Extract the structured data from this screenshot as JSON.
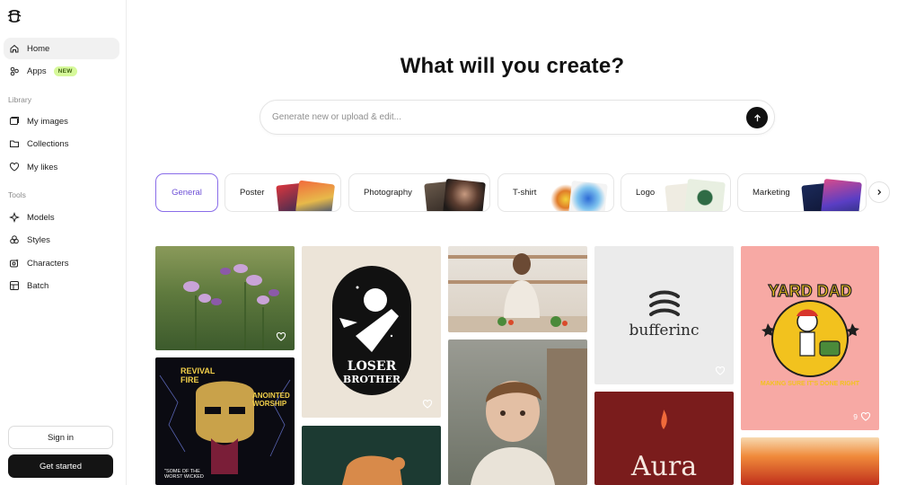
{
  "sidebar": {
    "nav": [
      {
        "label": "Home",
        "badge": ""
      },
      {
        "label": "Apps",
        "badge": "NEW"
      }
    ],
    "library_label": "Library",
    "library": [
      {
        "label": "My images"
      },
      {
        "label": "Collections"
      },
      {
        "label": "My likes"
      }
    ],
    "tools_label": "Tools",
    "tools": [
      {
        "label": "Models"
      },
      {
        "label": "Styles"
      },
      {
        "label": "Characters"
      },
      {
        "label": "Batch"
      }
    ],
    "sign_in": "Sign in",
    "get_started": "Get started"
  },
  "main": {
    "headline": "What will you create?",
    "search_placeholder": "Generate new or upload & edit..."
  },
  "categories": [
    {
      "label": "General",
      "selected": true
    },
    {
      "label": "Poster",
      "selected": false
    },
    {
      "label": "Photography",
      "selected": false
    },
    {
      "label": "T-shirt",
      "selected": false
    },
    {
      "label": "Logo",
      "selected": false
    },
    {
      "label": "Marketing",
      "selected": false
    }
  ],
  "gallery": {
    "logo_tile_text": "bufferinc",
    "poster_tile_line1": "LOSER",
    "poster_tile_line2": "BROTHER",
    "tshirt_tile_top": "YARD DAD",
    "tshirt_tile_bottom": "MAKING SURE IT'S DONE RIGHT",
    "tshirt_tile_likes": "9",
    "aura_tile_text": "Aura",
    "revival_left": "REVIVAL FIRE",
    "revival_right": "ANOINTED WORSHIP",
    "revival_bottom": "\"SOME OF THE WORST WICKED"
  },
  "colors": {
    "accent": "#7c5ce6",
    "new_badge_bg": "#d6f99a",
    "primary_button": "#141414"
  }
}
